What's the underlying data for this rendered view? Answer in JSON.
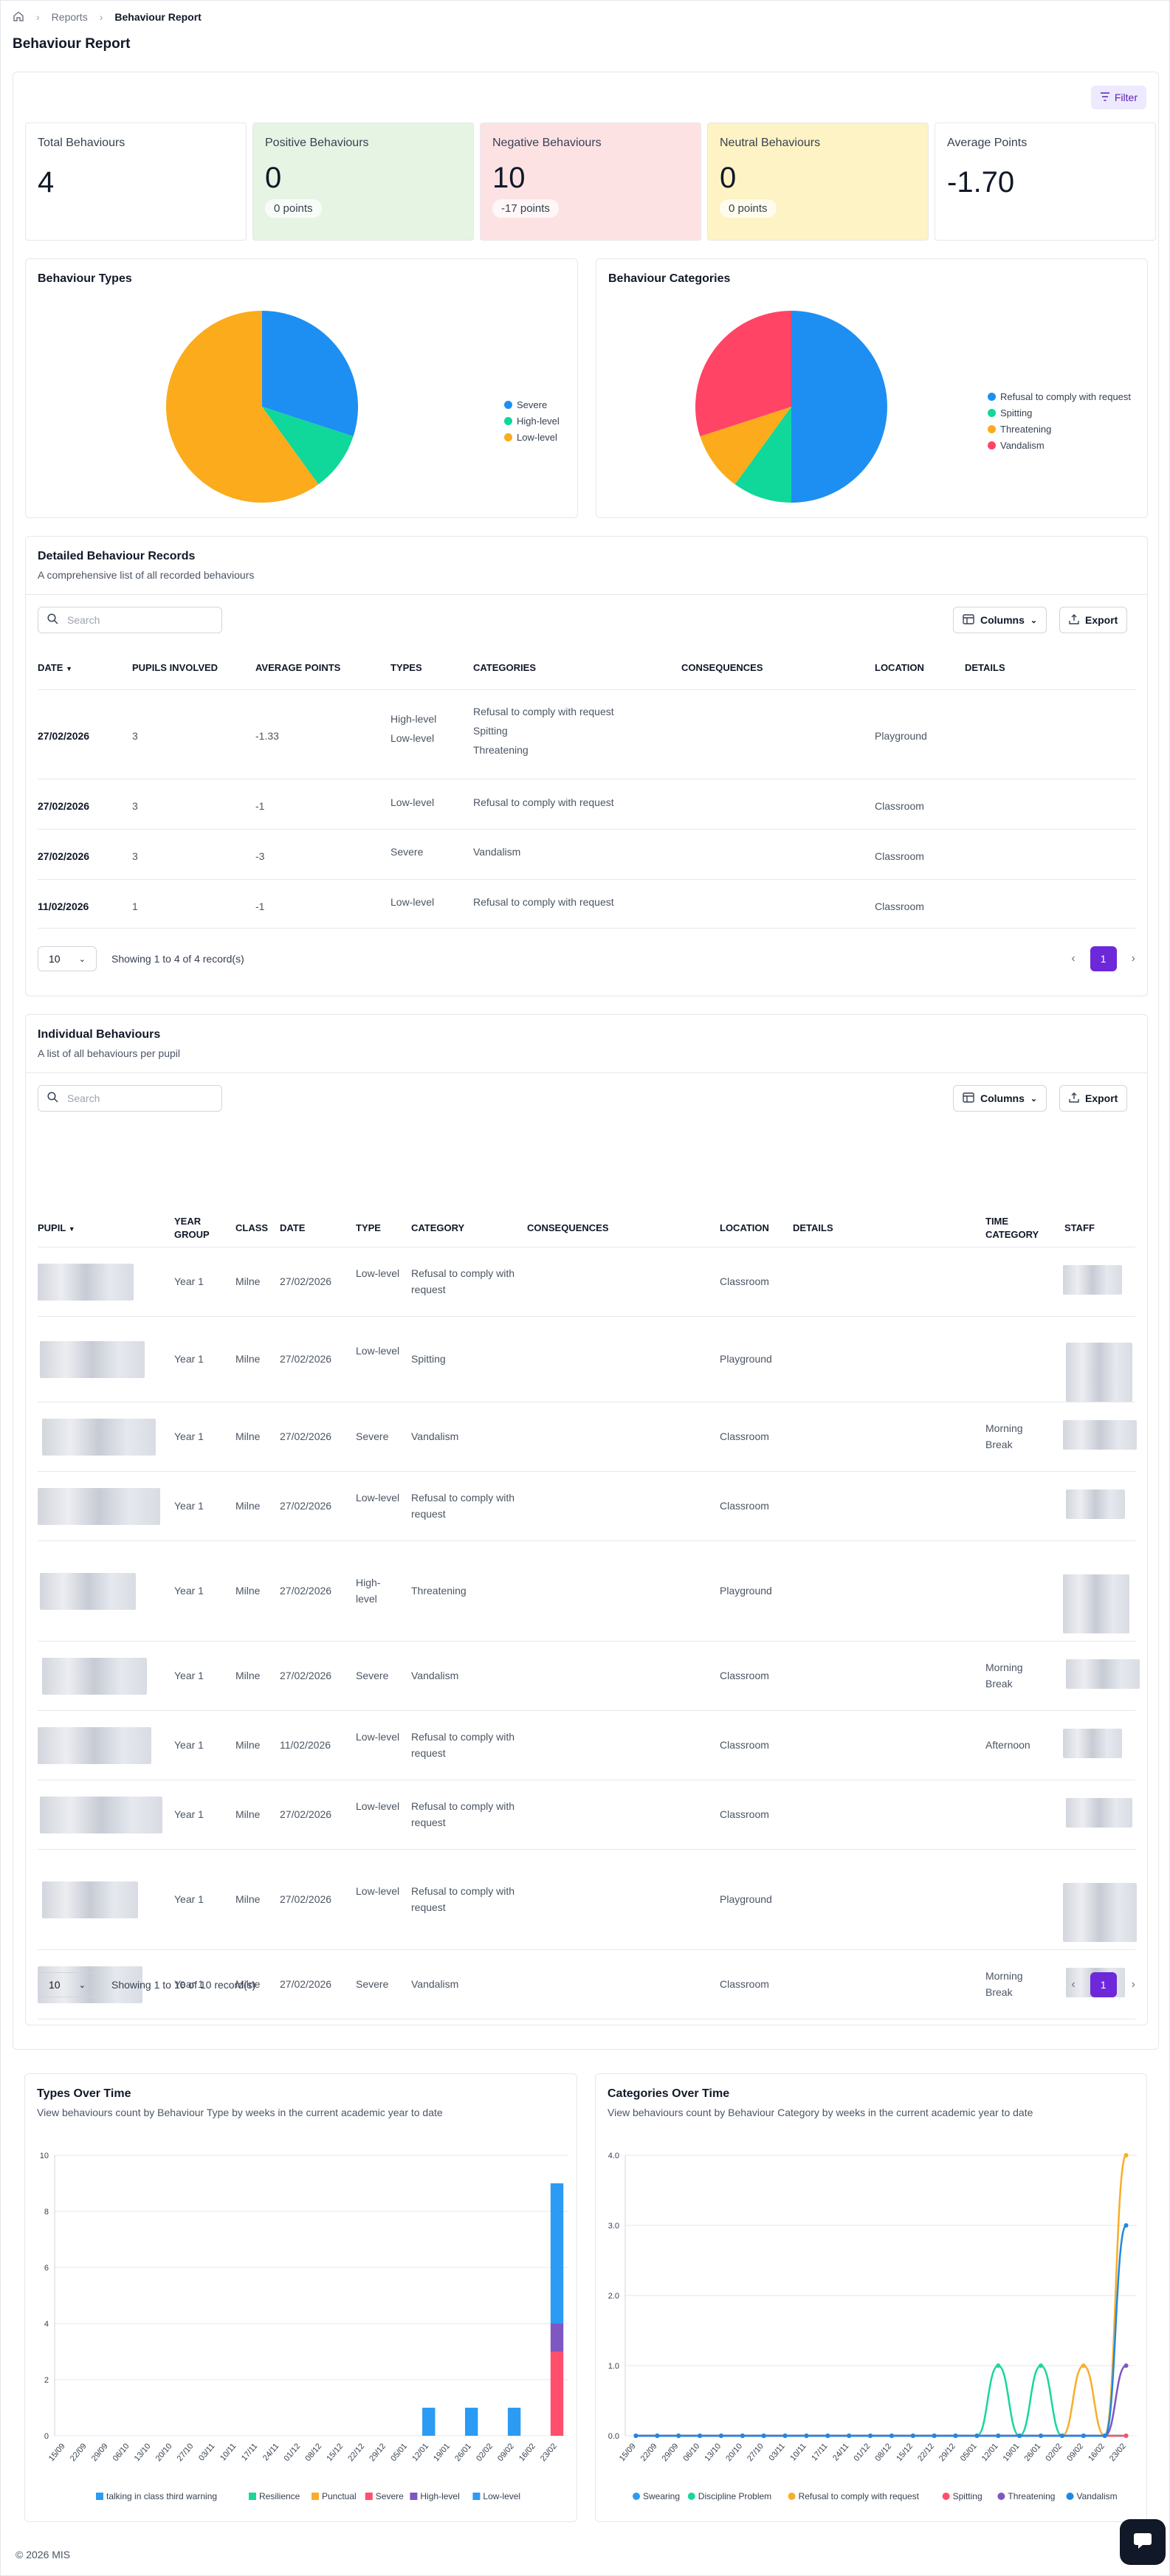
{
  "breadcrumb": {
    "reports": "Reports",
    "current": "Behaviour Report"
  },
  "page_title": "Behaviour Report",
  "filter_label": "Filter",
  "stats": [
    {
      "label": "Total Behaviours",
      "value": "4",
      "points": "",
      "bg": "#ffffff"
    },
    {
      "label": "Positive Behaviours",
      "value": "0",
      "points": "0 points",
      "bg": "#e6f4e4"
    },
    {
      "label": "Negative Behaviours",
      "value": "10",
      "points": "-17 points",
      "bg": "#fde2e4"
    },
    {
      "label": "Neutral Behaviours",
      "value": "0",
      "points": "0 points",
      "bg": "#fdf3c4"
    },
    {
      "label": "Average Points",
      "value": "-1.70",
      "points": "",
      "bg": "#ffffff"
    }
  ],
  "types_pie": {
    "title": "Behaviour Types",
    "legend": [
      "Severe",
      "High-level",
      "Low-level"
    ],
    "values": [
      3,
      1,
      6
    ],
    "colors": [
      "#1d8ff2",
      "#10d79a",
      "#fbab1c"
    ]
  },
  "categories_pie": {
    "title": "Behaviour Categories",
    "legend": [
      "Refusal to comply with request",
      "Spitting",
      "Threatening",
      "Vandalism"
    ],
    "values": [
      5,
      1,
      1,
      3
    ],
    "colors": [
      "#1d8ff2",
      "#10d79a",
      "#fbab1c",
      "#ff4466"
    ]
  },
  "detailed": {
    "title": "Detailed Behaviour Records",
    "subtitle": "A comprehensive list of all recorded behaviours",
    "search_placeholder": "Search",
    "columns_label": "Columns",
    "export_label": "Export",
    "headers": [
      "DATE",
      "PUPILS INVOLVED",
      "AVERAGE POINTS",
      "TYPES",
      "CATEGORIES",
      "CONSEQUENCES",
      "LOCATION",
      "DETAILS"
    ],
    "rows": [
      {
        "date": "27/02/2026",
        "pupils": "3",
        "avg": "-1.33",
        "types": [
          "High-level",
          "Low-level"
        ],
        "cats": [
          "Refusal to comply with request",
          "Spitting",
          "Threatening"
        ],
        "loc": "Playground"
      },
      {
        "date": "27/02/2026",
        "pupils": "3",
        "avg": "-1",
        "types": [
          "Low-level"
        ],
        "cats": [
          "Refusal to comply with request"
        ],
        "loc": "Classroom"
      },
      {
        "date": "27/02/2026",
        "pupils": "3",
        "avg": "-3",
        "types": [
          "Severe"
        ],
        "cats": [
          "Vandalism"
        ],
        "loc": "Classroom"
      },
      {
        "date": "11/02/2026",
        "pupils": "1",
        "avg": "-1",
        "types": [
          "Low-level"
        ],
        "cats": [
          "Refusal to comply with request"
        ],
        "loc": "Classroom"
      }
    ],
    "page_size": "10",
    "showing": "Showing 1 to 4 of 4 record(s)",
    "page": "1"
  },
  "individual": {
    "title": "Individual Behaviours",
    "subtitle": "A list of all behaviours per pupil",
    "search_placeholder": "Search",
    "columns_label": "Columns",
    "export_label": "Export",
    "headers": {
      "pupil": "PUPIL",
      "year_group": "YEAR GROUP",
      "class": "CLASS",
      "date": "DATE",
      "type": "TYPE",
      "category": "CATEGORY",
      "consequences": "CONSEQUENCES",
      "location": "LOCATION",
      "details": "DETAILS",
      "time_category": "TIME CATEGORY",
      "staff": "STAFF"
    },
    "rows": [
      {
        "year": "Year 1",
        "class": "Milne",
        "date": "27/02/2026",
        "type": "Low-level",
        "category": "Refusal to comply with request",
        "location": "Classroom",
        "time": ""
      },
      {
        "year": "Year 1",
        "class": "Milne",
        "date": "27/02/2026",
        "type": "Low-level",
        "category": "Spitting",
        "location": "Playground",
        "time": ""
      },
      {
        "year": "Year 1",
        "class": "Milne",
        "date": "27/02/2026",
        "type": "Severe",
        "category": "Vandalism",
        "location": "Classroom",
        "time": "Morning Break"
      },
      {
        "year": "Year 1",
        "class": "Milne",
        "date": "27/02/2026",
        "type": "Low-level",
        "category": "Refusal to comply with request",
        "location": "Classroom",
        "time": ""
      },
      {
        "year": "Year 1",
        "class": "Milne",
        "date": "27/02/2026",
        "type": "High-level",
        "category": "Threatening",
        "location": "Playground",
        "time": ""
      },
      {
        "year": "Year 1",
        "class": "Milne",
        "date": "27/02/2026",
        "type": "Severe",
        "category": "Vandalism",
        "location": "Classroom",
        "time": "Morning Break"
      },
      {
        "year": "Year 1",
        "class": "Milne",
        "date": "11/02/2026",
        "type": "Low-level",
        "category": "Refusal to comply with request",
        "location": "Classroom",
        "time": "Afternoon"
      },
      {
        "year": "Year 1",
        "class": "Milne",
        "date": "27/02/2026",
        "type": "Low-level",
        "category": "Refusal to comply with request",
        "location": "Classroom",
        "time": ""
      },
      {
        "year": "Year 1",
        "class": "Milne",
        "date": "27/02/2026",
        "type": "Low-level",
        "category": "Refusal to comply with request",
        "location": "Playground",
        "time": ""
      },
      {
        "year": "Year 1",
        "class": "Milne",
        "date": "27/02/2026",
        "type": "Severe",
        "category": "Vandalism",
        "location": "Classroom",
        "time": "Morning Break"
      }
    ],
    "page_size": "10",
    "showing": "Showing 1 to 10 of 10 record(s)",
    "page": "1"
  },
  "types_over_time": {
    "title": "Types Over Time",
    "subtitle": "View behaviours count by Behaviour Type by weeks in the current academic year to date"
  },
  "categories_over_time": {
    "title": "Categories Over Time",
    "subtitle": "View behaviours count by Behaviour Category by weeks in the current academic year to date"
  },
  "chart_data": [
    {
      "type": "bar",
      "stacked": true,
      "categories": [
        "15/09",
        "22/09",
        "29/09",
        "06/10",
        "13/10",
        "20/10",
        "27/10",
        "03/11",
        "10/11",
        "17/11",
        "24/11",
        "01/12",
        "08/12",
        "15/12",
        "22/12",
        "29/12",
        "05/01",
        "12/01",
        "19/01",
        "26/01",
        "02/02",
        "09/02",
        "16/02",
        "23/02"
      ],
      "series": [
        {
          "name": "talking in class third warning",
          "color": "#2b9bf4",
          "values": [
            0,
            0,
            0,
            0,
            0,
            0,
            0,
            0,
            0,
            0,
            0,
            0,
            0,
            0,
            0,
            0,
            0,
            0,
            0,
            0,
            0,
            0,
            0,
            0
          ]
        },
        {
          "name": "Resilience",
          "color": "#19d69e",
          "values": [
            0,
            0,
            0,
            0,
            0,
            0,
            0,
            0,
            0,
            0,
            0,
            0,
            0,
            0,
            0,
            0,
            0,
            0,
            0,
            0,
            0,
            0,
            0,
            0
          ]
        },
        {
          "name": "Punctual",
          "color": "#f9ad2a",
          "values": [
            0,
            0,
            0,
            0,
            0,
            0,
            0,
            0,
            0,
            0,
            0,
            0,
            0,
            0,
            0,
            0,
            0,
            0,
            0,
            0,
            0,
            0,
            0,
            0
          ]
        },
        {
          "name": "Severe",
          "color": "#ff4f6c",
          "values": [
            0,
            0,
            0,
            0,
            0,
            0,
            0,
            0,
            0,
            0,
            0,
            0,
            0,
            0,
            0,
            0,
            0,
            0,
            0,
            0,
            0,
            0,
            0,
            3
          ]
        },
        {
          "name": "High-level",
          "color": "#7e57c2",
          "values": [
            0,
            0,
            0,
            0,
            0,
            0,
            0,
            0,
            0,
            0,
            0,
            0,
            0,
            0,
            0,
            0,
            0,
            0,
            0,
            0,
            0,
            0,
            0,
            1
          ]
        },
        {
          "name": "Low-level",
          "color": "#2b9bf4",
          "values": [
            0,
            0,
            0,
            0,
            0,
            0,
            0,
            0,
            0,
            0,
            0,
            0,
            0,
            0,
            0,
            0,
            0,
            1,
            0,
            1,
            0,
            1,
            0,
            5
          ]
        }
      ],
      "ylim": [
        0,
        10
      ],
      "yticks": [
        0,
        2,
        4,
        6,
        8,
        10
      ],
      "legend": "bottom",
      "grid": true
    },
    {
      "type": "line",
      "x": [
        "15/09",
        "22/09",
        "29/09",
        "06/10",
        "13/10",
        "20/10",
        "27/10",
        "03/11",
        "10/11",
        "17/11",
        "24/11",
        "01/12",
        "08/12",
        "15/12",
        "22/12",
        "29/12",
        "05/01",
        "12/01",
        "19/01",
        "26/01",
        "02/02",
        "09/02",
        "16/02",
        "23/02"
      ],
      "series": [
        {
          "name": "Swearing",
          "color": "#2b9bf4",
          "values": [
            0,
            0,
            0,
            0,
            0,
            0,
            0,
            0,
            0,
            0,
            0,
            0,
            0,
            0,
            0,
            0,
            0,
            0,
            0,
            0,
            0,
            0,
            0,
            0
          ]
        },
        {
          "name": "Discipline Problem",
          "color": "#19d69e",
          "values": [
            0,
            0,
            0,
            0,
            0,
            0,
            0,
            0,
            0,
            0,
            0,
            0,
            0,
            0,
            0,
            0,
            0,
            1,
            0,
            1,
            0,
            0,
            0,
            0
          ]
        },
        {
          "name": "Refusal to comply with request",
          "color": "#f9ad2a",
          "values": [
            0,
            0,
            0,
            0,
            0,
            0,
            0,
            0,
            0,
            0,
            0,
            0,
            0,
            0,
            0,
            0,
            0,
            0,
            0,
            0,
            0,
            1,
            0,
            4
          ]
        },
        {
          "name": "Spitting",
          "color": "#ff4f6c",
          "values": [
            0,
            0,
            0,
            0,
            0,
            0,
            0,
            0,
            0,
            0,
            0,
            0,
            0,
            0,
            0,
            0,
            0,
            0,
            0,
            0,
            0,
            0,
            0,
            0
          ]
        },
        {
          "name": "Threatening",
          "color": "#7e57c2",
          "values": [
            0,
            0,
            0,
            0,
            0,
            0,
            0,
            0,
            0,
            0,
            0,
            0,
            0,
            0,
            0,
            0,
            0,
            0,
            0,
            0,
            0,
            0,
            0,
            1
          ]
        },
        {
          "name": "Vandalism",
          "color": "#1e88e5",
          "values": [
            0,
            0,
            0,
            0,
            0,
            0,
            0,
            0,
            0,
            0,
            0,
            0,
            0,
            0,
            0,
            0,
            0,
            0,
            0,
            0,
            0,
            0,
            0,
            3
          ]
        }
      ],
      "ylim": [
        0,
        4
      ],
      "yticks": [
        "0.0",
        "1.0",
        "2.0",
        "3.0",
        "4.0"
      ],
      "legend": "bottom",
      "grid": true
    }
  ],
  "footer": "© 2026 MIS"
}
